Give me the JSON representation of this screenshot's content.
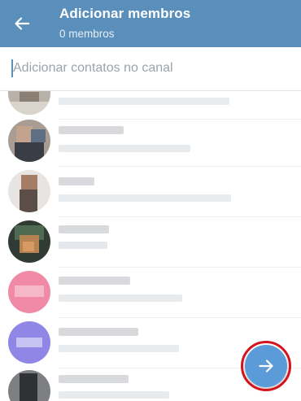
{
  "colors": {
    "header_bg": "#5a8fbb",
    "fab_bg": "#5b9bd8",
    "highlight_ring": "#d3141d"
  },
  "header": {
    "back_icon": "arrow-left-icon",
    "title": "Adicionar membros",
    "subtitle": "0 membros"
  },
  "search": {
    "placeholder": "Adicionar contatos no canal",
    "value": ""
  },
  "fab": {
    "icon": "arrow-right-icon"
  }
}
